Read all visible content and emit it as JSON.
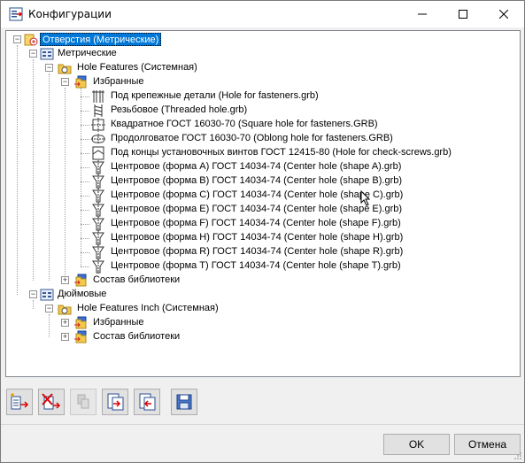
{
  "window": {
    "title": "Конфигурации",
    "icon": "config-app-icon"
  },
  "tree": {
    "root": {
      "label": "Отверстия (Метрические)",
      "expanded": true,
      "selected": true,
      "icon": "holes-root-icon"
    },
    "metric": {
      "label": "Метрические",
      "icon": "config-group-icon",
      "hole_features": {
        "label": "Hole Features (Системная)",
        "icon": "library-folder-icon",
        "favorites": {
          "label": "Избранные",
          "icon": "favorites-folder-icon",
          "items": [
            {
              "label": "Под крепежные детали (Hole for fasteners.grb)",
              "icon": "fastener-hole-icon"
            },
            {
              "label": "Резьбовое (Threaded hole.grb)",
              "icon": "threaded-hole-icon"
            },
            {
              "label": "Квадратное ГОСТ 16030-70 (Square hole for fasteners.GRB)",
              "icon": "square-hole-icon"
            },
            {
              "label": "Продолговатое ГОСТ 16030-70 (Oblong hole for fasteners.GRB)",
              "icon": "oblong-hole-icon"
            },
            {
              "label": "Под концы установочных винтов ГОСТ 12415-80 (Hole for check-screws.grb)",
              "icon": "check-screw-hole-icon"
            },
            {
              "label": "Центровое (форма A) ГОСТ 14034-74 (Center hole (shape A).grb)",
              "icon": "center-hole-icon"
            },
            {
              "label": "Центровое (форма B) ГОСТ 14034-74 (Center hole (shape B).grb)",
              "icon": "center-hole-icon"
            },
            {
              "label": "Центровое (форма C) ГОСТ 14034-74 (Center hole (shape C).grb)",
              "icon": "center-hole-icon"
            },
            {
              "label": "Центровое (форма E) ГОСТ 14034-74 (Center hole (shape E).grb)",
              "icon": "center-hole-icon"
            },
            {
              "label": "Центровое (форма F) ГОСТ 14034-74 (Center hole (shape F).grb)",
              "icon": "center-hole-icon"
            },
            {
              "label": "Центровое (форма H) ГОСТ 14034-74 (Center hole (shape H).grb)",
              "icon": "center-hole-icon"
            },
            {
              "label": "Центровое (форма R) ГОСТ 14034-74 (Center hole (shape R).grb)",
              "icon": "center-hole-icon"
            },
            {
              "label": "Центровое (форма T) ГОСТ 14034-74 (Center hole (shape T).grb)",
              "icon": "center-hole-icon"
            }
          ]
        },
        "library": {
          "label": "Состав библиотеки",
          "icon": "library-content-icon"
        }
      }
    },
    "inch": {
      "label": "Дюймовые",
      "icon": "config-group-icon",
      "hole_features": {
        "label": "Hole Features Inch (Системная)",
        "icon": "library-folder-icon",
        "favorites": {
          "label": "Избранные",
          "icon": "favorites-folder-icon"
        },
        "library": {
          "label": "Состав библиотеки",
          "icon": "library-content-icon"
        }
      }
    }
  },
  "toolbar": {
    "buttons": [
      {
        "name": "new-config-button",
        "icon": "new-config-icon",
        "enabled": true
      },
      {
        "name": "delete-config-button",
        "icon": "delete-config-icon",
        "enabled": true
      },
      {
        "name": "properties-button",
        "icon": "properties-icon",
        "enabled": false
      },
      {
        "name": "import-button",
        "icon": "import-icon",
        "enabled": true
      },
      {
        "name": "export-button",
        "icon": "export-icon",
        "enabled": true
      },
      {
        "name": "save-button",
        "icon": "save-icon",
        "enabled": true
      }
    ]
  },
  "buttons": {
    "ok": "OK",
    "cancel": "Отмена"
  },
  "colors": {
    "selection": "#0078d7",
    "window_bg": "#f0f0f0"
  }
}
